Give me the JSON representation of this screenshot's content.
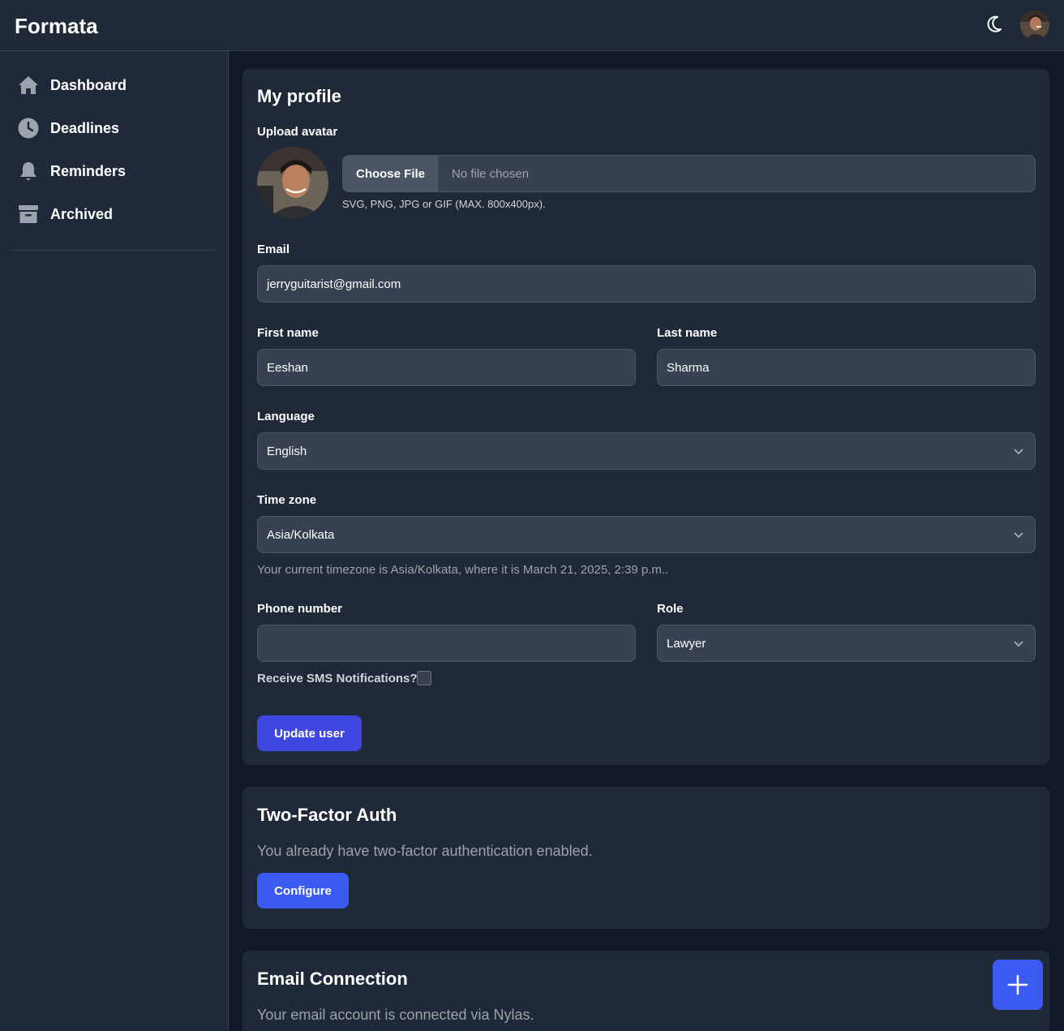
{
  "app": {
    "brand": "Formata"
  },
  "header": {
    "theme_icon": "moon-icon",
    "avatar_icon": "user-avatar"
  },
  "sidebar": {
    "items": [
      {
        "label": "Dashboard",
        "icon": "home-icon"
      },
      {
        "label": "Deadlines",
        "icon": "clock-icon"
      },
      {
        "label": "Reminders",
        "icon": "bell-icon"
      },
      {
        "label": "Archived",
        "icon": "archive-icon"
      }
    ]
  },
  "profile": {
    "title": "My profile",
    "upload_label": "Upload avatar",
    "choose_file": "Choose File",
    "file_status": "No file chosen",
    "file_help": "SVG, PNG, JPG or GIF (MAX. 800x400px).",
    "email_label": "Email",
    "email_value": "jerryguitarist@gmail.com",
    "first_name_label": "First name",
    "first_name_value": "Eeshan",
    "last_name_label": "Last name",
    "last_name_value": "Sharma",
    "language_label": "Language",
    "language_value": "English",
    "timezone_label": "Time zone",
    "timezone_value": "Asia/Kolkata",
    "timezone_note": "Your current timezone is Asia/Kolkata, where it is March 21, 2025, 2:39 p.m..",
    "phone_label": "Phone number",
    "phone_value": "",
    "role_label": "Role",
    "role_value": "Lawyer",
    "sms_label": "Receive SMS Notifications?",
    "sms_checked": false,
    "update_button": "Update user"
  },
  "two_factor": {
    "title": "Two-Factor Auth",
    "text": "You already have two-factor authentication enabled.",
    "button": "Configure"
  },
  "email_connection": {
    "title": "Email Connection",
    "text": "Your email account is connected via Nylas."
  },
  "fab": {
    "icon": "plus-icon"
  },
  "colors": {
    "bg": "#111827",
    "surface": "#1f2937",
    "input": "#374151",
    "primary_button": "#4046e0",
    "configure_button": "#3b5bf0",
    "fab": "#3b5bf0"
  }
}
